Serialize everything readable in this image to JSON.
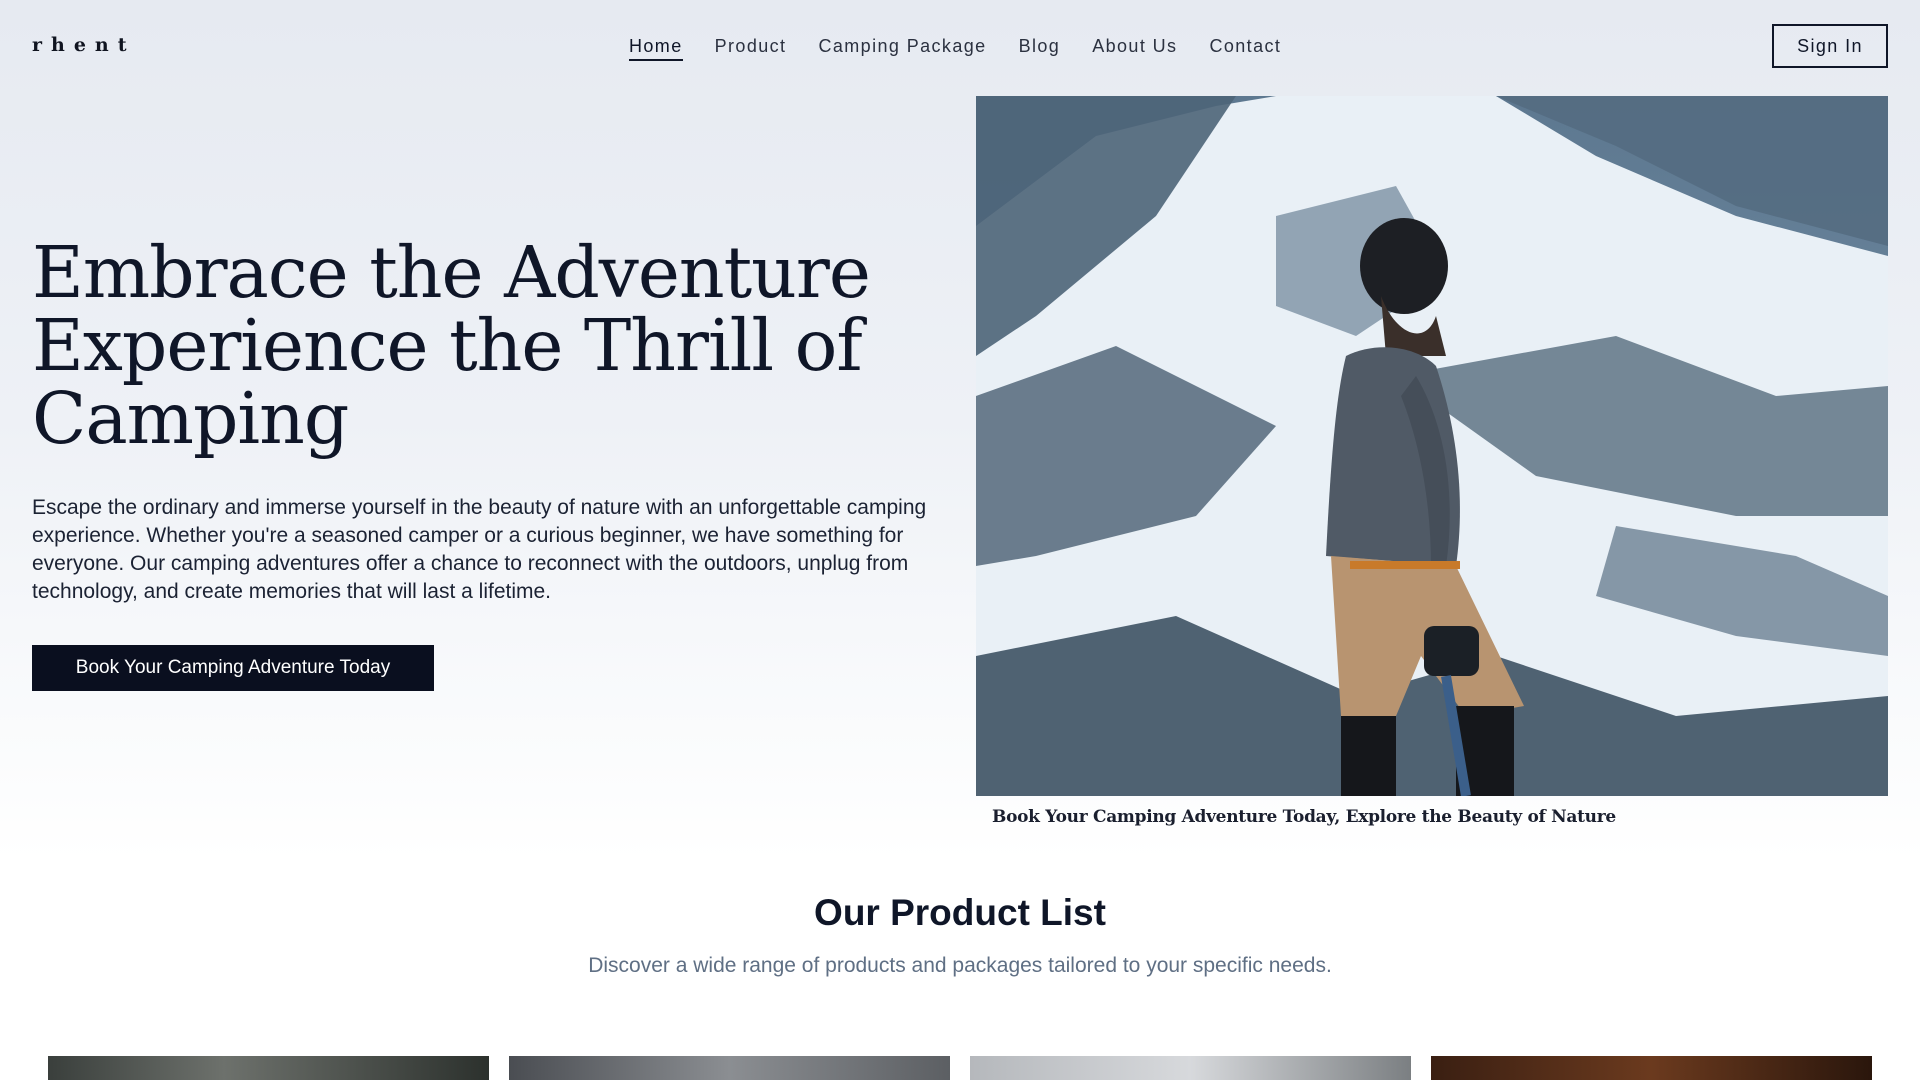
{
  "header": {
    "logo": "rhent",
    "nav": [
      "Home",
      "Product",
      "Camping Package",
      "Blog",
      "About Us",
      "Contact"
    ],
    "active_nav": "Home",
    "sign_in": "Sign In"
  },
  "hero": {
    "title_lines": [
      "Embrace the Adventure",
      "Experience the Thrill of",
      "Camping"
    ],
    "description": "Escape the ordinary and immerse yourself in the beauty of nature with an unforgettable camping experience. Whether you're a seasoned camper or a curious beginner, we have something for everyone. Our camping adventures offer a chance to reconnect with the outdoors, unplug from technology, and create memories that will last a lifetime.",
    "cta": "Book Your Camping Adventure Today",
    "image_caption": "Book Your Camping Adventure Today, Explore the Beauty of Nature"
  },
  "products": {
    "title": "Our Product List",
    "subtitle": "Discover a wide range of products and packages tailored to your specific needs."
  },
  "colors": {
    "primary": "#0a0f1f",
    "text": "#0f1628",
    "muted": "#5f6f84"
  }
}
